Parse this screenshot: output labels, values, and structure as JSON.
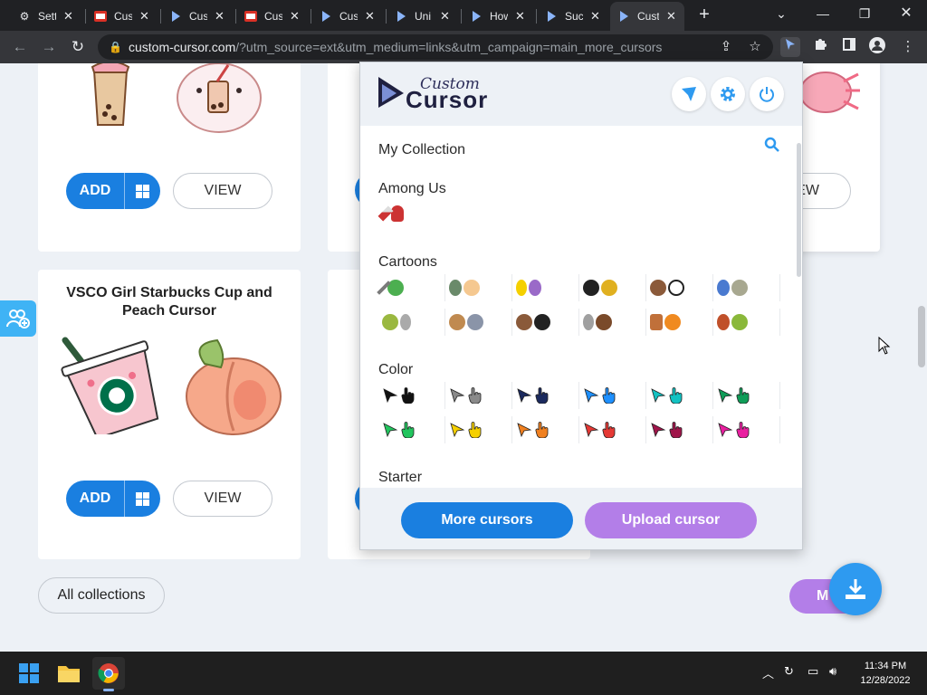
{
  "browser": {
    "tabs": [
      {
        "label": "Setti",
        "favicon": "gear-icon"
      },
      {
        "label": "Cus",
        "favicon": "image-icon"
      },
      {
        "label": "Cus",
        "favicon": "cursor-arrow-icon"
      },
      {
        "label": "Cus",
        "favicon": "image-icon"
      },
      {
        "label": "Cus",
        "favicon": "cursor-arrow-icon"
      },
      {
        "label": "Uni",
        "favicon": "cursor-arrow-icon"
      },
      {
        "label": "How",
        "favicon": "cursor-arrow-icon"
      },
      {
        "label": "Suc",
        "favicon": "cursor-arrow-icon"
      },
      {
        "label": "Cust",
        "favicon": "cursor-arrow-icon",
        "active": true
      }
    ],
    "url_host": "custom-cursor.com",
    "url_rest": "/?utm_source=ext&utm_medium=links&utm_campaign=main_more_cursors"
  },
  "page": {
    "cards": [
      {
        "title": "",
        "add_label": "ADD",
        "view_label": "VIEW"
      },
      {
        "title": "",
        "view_label": "EW"
      },
      {
        "title": "VSCO Girl Starbucks Cup and Peach Cursor",
        "add_label": "ADD",
        "view_label": "VIEW"
      }
    ],
    "all_collections_label": "All collections",
    "more_partial_label": "M"
  },
  "popup": {
    "logo_line1": "Custom",
    "logo_line2": "Cursor",
    "my_collection": "My Collection",
    "sections": [
      {
        "title": "Among Us"
      },
      {
        "title": "Cartoons"
      },
      {
        "title": "Color"
      },
      {
        "title": "Starter"
      }
    ],
    "color_pairs_row1": [
      "#111111",
      "#8a8a8a",
      "#1b2a5e",
      "#1e90ff",
      "#13c2c2",
      "#0f9d58"
    ],
    "color_pairs_row2": [
      "#22c55e",
      "#f5d000",
      "#f08020",
      "#e53935",
      "#a0154a",
      "#e91ea0"
    ],
    "more_cursors_label": "More cursors",
    "upload_cursor_label": "Upload cursor",
    "colors": {
      "more": "#1a7fe0",
      "upload": "#b37ee8"
    }
  },
  "taskbar": {
    "time": "11:34 PM",
    "date": "12/28/2022"
  }
}
